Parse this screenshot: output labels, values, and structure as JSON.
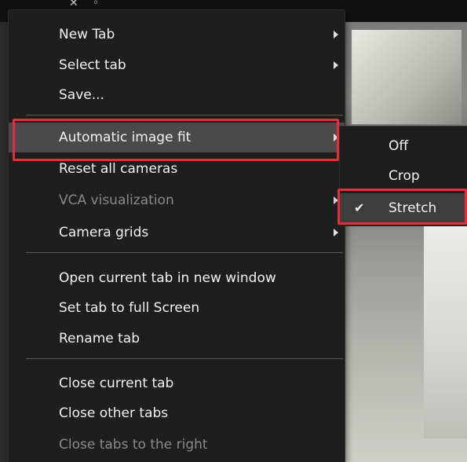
{
  "context_menu": {
    "items": [
      {
        "label": "New Tab",
        "submenu": true,
        "disabled": false
      },
      {
        "label": "Select tab",
        "submenu": true,
        "disabled": false
      },
      {
        "label": "Save...",
        "submenu": false,
        "disabled": false
      },
      {
        "label": "Automatic image fit",
        "submenu": true,
        "disabled": false,
        "highlighted": true
      },
      {
        "label": "Reset all cameras",
        "submenu": false,
        "disabled": false
      },
      {
        "label": "VCA visualization",
        "submenu": true,
        "disabled": true
      },
      {
        "label": "Camera grids",
        "submenu": true,
        "disabled": false
      },
      {
        "label": "Open current tab in new window",
        "submenu": false,
        "disabled": false
      },
      {
        "label": "Set tab to full Screen",
        "submenu": false,
        "disabled": false
      },
      {
        "label": "Rename tab",
        "submenu": false,
        "disabled": false
      },
      {
        "label": "Close current tab",
        "submenu": false,
        "disabled": false
      },
      {
        "label": "Close other tabs",
        "submenu": false,
        "disabled": false
      },
      {
        "label": "Close tabs to the right",
        "submenu": false,
        "disabled": true
      }
    ]
  },
  "image_fit_submenu": {
    "items": [
      {
        "label": "Off",
        "checked": false
      },
      {
        "label": "Crop",
        "checked": false
      },
      {
        "label": "Stretch",
        "checked": true
      }
    ],
    "check_glyph": "✔"
  },
  "colors": {
    "menu_background": "#1e1e1e",
    "highlight": "#4a4a4a",
    "annotation_red": "#e0303a",
    "disabled_text": "#8a8a8a"
  }
}
